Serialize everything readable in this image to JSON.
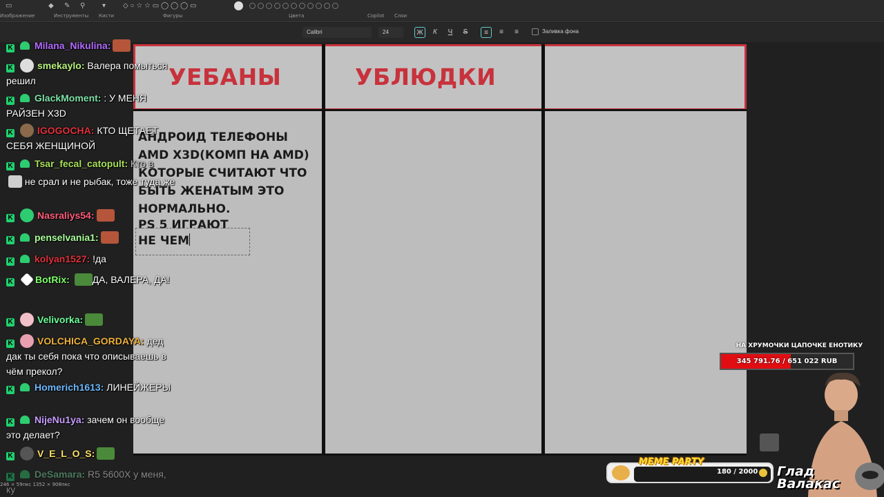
{
  "ribbon": {
    "groups": [
      "Изображение",
      "Инструменты",
      "Кисти",
      "Фигуры",
      "Цвета",
      "Copilot",
      "Слои"
    ]
  },
  "format_bar": {
    "font": "Calibri",
    "size": "24",
    "bold": "Ж",
    "italic": "К",
    "underline": "Ч",
    "strike": "S",
    "fill_label": "Заливка фона"
  },
  "canvas": {
    "columns": [
      "УЕБАНЫ",
      "УБЛЮДКИ",
      ""
    ],
    "lines": [
      "АНДРОИД ТЕЛЕФОНЫ",
      "AMD X3D(КОМП НА AMD)",
      "КОТОРЫЕ СЧИТАЮТ ЧТО",
      "БЫТЬ ЖЕНАТЫМ ЭТО",
      "НОРМАЛЬНО.",
      "PS 5 ИГРАЮТ",
      "НЕ ЧЕМ"
    ]
  },
  "chat": [
    {
      "nick": "Milana_Nikulina:",
      "text": "",
      "color": "#b36cff"
    },
    {
      "nick": "smekaylo:",
      "text": "Валера помыться решил",
      "color": "#b9f27c"
    },
    {
      "nick": "GlackMoment:",
      "text": ": У МЕНЯ РАЙЗЕН X3D",
      "color": "#7ee2a8"
    },
    {
      "nick": "IGOGOCHA:",
      "text": "КТО ЩЕТАЕТ СЕБЯ ЖЕНЩИНОЙ",
      "color": "#e0323c"
    },
    {
      "nick": "Tsar_fecal_catopult:",
      "text": "Кто в",
      "color": "#a8e05a"
    },
    {
      "nick": "",
      "text": "не срал и не рыбак, тоже туда же",
      "color": "#ffffff"
    },
    {
      "nick": "Nasraliys54:",
      "text": "",
      "color": "#ff5c7a"
    },
    {
      "nick": "penselvania1:",
      "text": "",
      "color": "#a8ff9a"
    },
    {
      "nick": "kolyan1527:",
      "text": "!да",
      "color": "#e0323c"
    },
    {
      "nick": "BotRix:",
      "text": "ДА, ВАЛЕРА, ДА!",
      "color": "#7fff6a"
    },
    {
      "nick": "Velivorka:",
      "text": "",
      "color": "#6cff9a"
    },
    {
      "nick": "VOLCHICA_GORDAYA:",
      "text": "дед дак ты себя пока что описываешь в чём прекол?",
      "color": "#f0b23c"
    },
    {
      "nick": "Homerich1613:",
      "text": "ЛИНЕЙЖЕРЫ",
      "color": "#6cb8ff"
    },
    {
      "nick": "NijeNu1ya:",
      "text": "зачем он вообще это делает?",
      "color": "#c89cff"
    },
    {
      "nick": "V_E_L_O_S:",
      "text": "",
      "color": "#ffe066"
    },
    {
      "nick": "DeSamara:",
      "text": "R5 5600X у меня, ку",
      "color": "#7ee2a8"
    }
  ],
  "goal": {
    "title": "НА ХРУМОЧКИ ЦАПОЧКЕ ЕНОТИКУ",
    "text": "345 791.76 / 651 022 RUB",
    "progress": 0.531
  },
  "meme_party": {
    "title": "MEME PARTY",
    "count": "180 / 2000"
  },
  "brand": {
    "line1": "Глад",
    "line2": "Валакас"
  },
  "statusbar": {
    "text": "246 × 59пкс    1352 × 908пкс"
  },
  "colors": {
    "accent_red": "#c8323c",
    "chat_badge": "#1fd170",
    "goal_fill": "#e00d12"
  }
}
